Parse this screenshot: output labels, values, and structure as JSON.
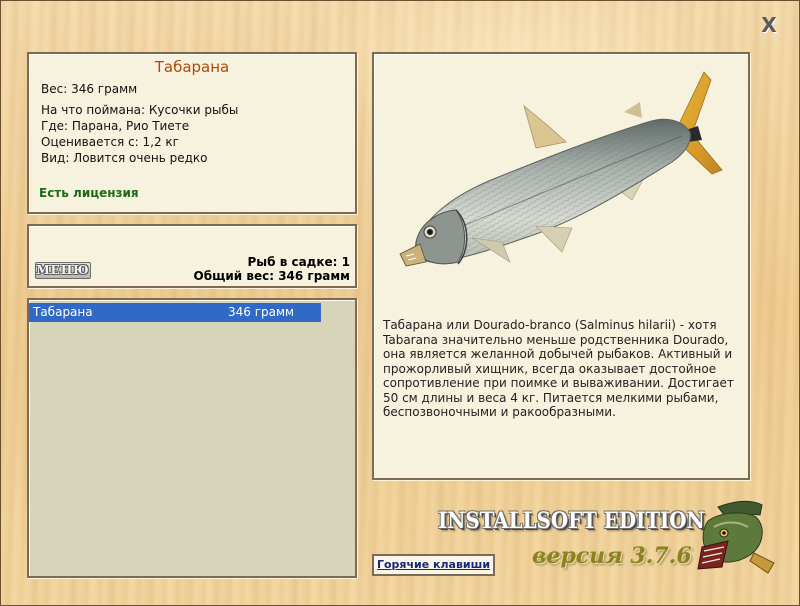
{
  "close_symbol": "X",
  "fish": {
    "name": "Табарана",
    "weight_line": "Вес: 346 грамм",
    "bait_line": "На что поймана: Кусочки рыбы",
    "location_line": "Где: Парана, Рио Тиете",
    "valued_line": "Оценивается с: 1,2 кг",
    "kind_line": "Вид: Ловится очень редко",
    "license": "Есть лицензия"
  },
  "cage": {
    "menu_label": "МЕНЮ",
    "count_line": "Рыб в садке: 1",
    "total_line": "Общий вес: 346 грамм"
  },
  "catch_list": [
    {
      "name": "Табарана",
      "weight": "346 грамм",
      "selected": true
    }
  ],
  "description": "Табарана или Dourado-branco (Salminus hilarii) - хотя Tabarana значительно меньше родственника Dourado, она является желанной добычей рыбаков. Активный и прожорливый хищник, всегда оказывает достойное сопротивление при поимке и вываживании. Достигает 50 см длины и веса 4 кг. Питается мелкими рыбами, беспозвоночными и ракообразными.",
  "hotkeys_label": "Горячие клавиши",
  "edition": "INSTALLSOFT EDITION",
  "version": "версия 3.7.6",
  "icons": {
    "close": "close-icon",
    "fish_photo": "tabarana-fish-image",
    "logo": "pike-logo"
  },
  "colors": {
    "selection": "#3169c6",
    "fish_name": "#b0490e",
    "license": "#1c6a16",
    "hotkeys": "#14297a"
  }
}
